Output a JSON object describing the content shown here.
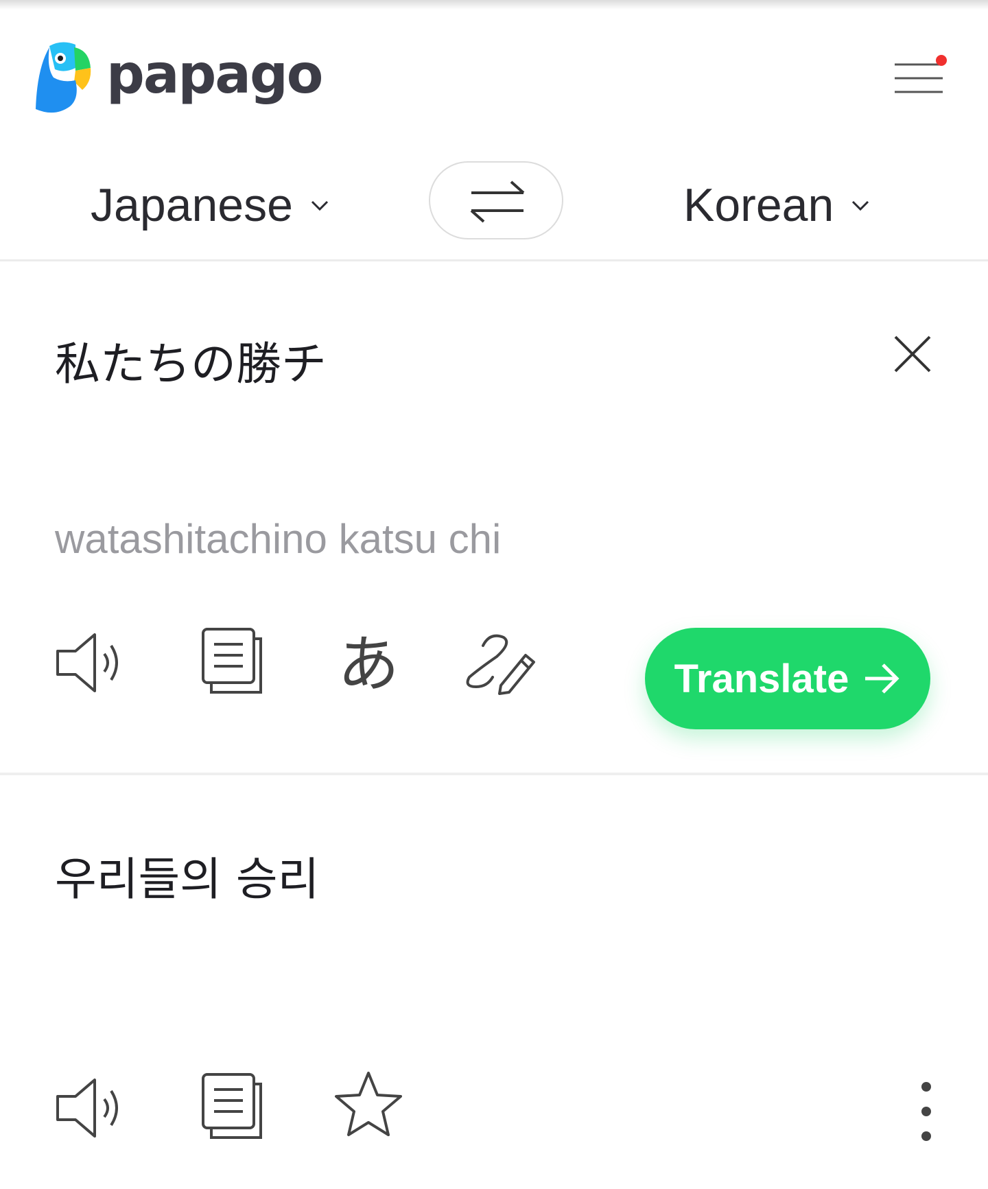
{
  "app": {
    "brand": "papago"
  },
  "colors": {
    "accent": "#1fd86b",
    "notification_dot": "#f0302e",
    "brand_text": "#3c3c46",
    "muted_text": "#9a9a9f"
  },
  "languages": {
    "source": "Japanese",
    "target": "Korean"
  },
  "source": {
    "text": "私たちの勝チ",
    "pronunciation": "watashitachino katsu chi",
    "translate_label": "Translate"
  },
  "target": {
    "text": "우리들의 승리"
  },
  "icons": {
    "menu": "hamburger-menu-icon",
    "swap": "swap-arrows-icon",
    "clear": "close-icon",
    "speaker": "speaker-icon",
    "copy": "copy-icon",
    "hiragana": "hiragana-keyboard-icon",
    "handwriting": "handwriting-icon",
    "star": "star-icon",
    "more": "more-vertical-icon"
  }
}
